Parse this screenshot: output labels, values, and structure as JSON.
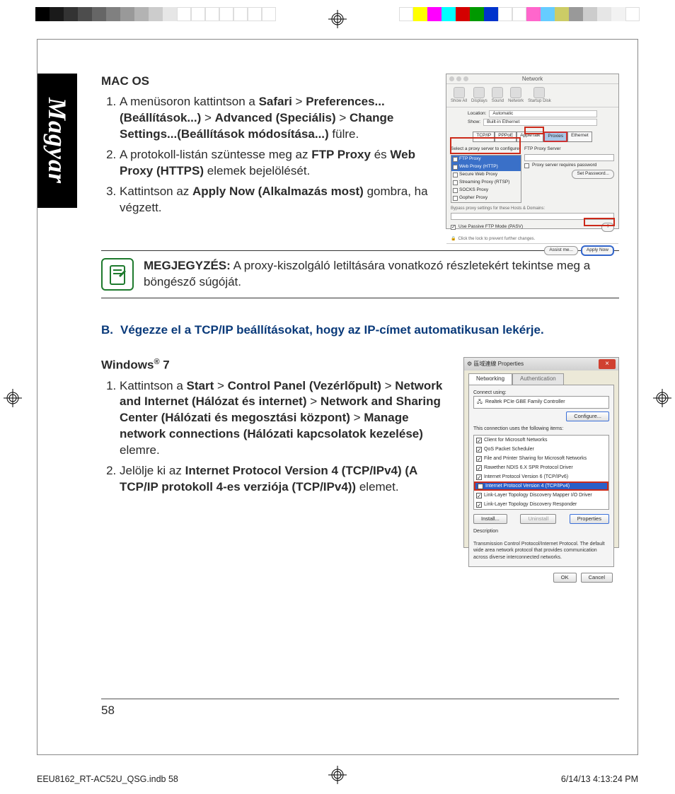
{
  "language_tab": "Magyar",
  "mac": {
    "heading": "MAC OS",
    "step1_parts": [
      "A menüsoron kattintson a ",
      "Safari",
      " > ",
      "Preferences... (Beállítások...)",
      " > ",
      "Advanced (Speciális)",
      " > ",
      "Change  Settings...(Beállítások módosítása...)",
      " fülre."
    ],
    "step2_parts": [
      "A protokoll-listán szüntesse meg az ",
      "FTP Proxy",
      " és ",
      "Web Proxy (HTTPS)",
      " elemek bejelölését."
    ],
    "step3_parts": [
      "Kattintson az ",
      "Apply Now (Alkalmazás most)",
      " gombra, ha végzett."
    ],
    "screenshot": {
      "title": "Network",
      "toolbar": [
        "Show All",
        "Displays",
        "Sound",
        "Network",
        "Startup Disk"
      ],
      "loc_label": "Location:",
      "loc_value": "Automatic",
      "show_label": "Show:",
      "show_value": "Built-in Ethernet",
      "tabs": [
        "TCP/IP",
        "PPPoE",
        "AppleTalk",
        "Proxies",
        "Ethernet"
      ],
      "selected_tab": "Proxies",
      "left_title": "Select a proxy server to configure:",
      "right_title": "FTP Proxy Server",
      "proxy_list": [
        {
          "label": "FTP Proxy",
          "checked": true,
          "sel": true
        },
        {
          "label": "Web Proxy (HTTP)",
          "checked": true,
          "sel": true
        },
        {
          "label": "Secure Web Proxy",
          "checked": false,
          "sel": false
        },
        {
          "label": "Streaming Proxy (RTSP)",
          "checked": false,
          "sel": false
        },
        {
          "label": "SOCKS Proxy",
          "checked": false,
          "sel": false
        },
        {
          "label": "Gopher Proxy",
          "checked": false,
          "sel": false
        }
      ],
      "pw_cb": "Proxy server requires password",
      "set_pw": "Set Password...",
      "bypass": "Bypass proxy settings for these Hosts & Domains:",
      "pasv": "Use Passive FTP Mode (PASV)",
      "lock": "Click the lock to prevent further changes.",
      "assist": "Assist me...",
      "apply": "Apply Now"
    }
  },
  "note": {
    "label": "MEGJEGYZÉS:",
    "text": "   A proxy-kiszolgáló letiltására vonatkozó részletekért tekintse meg a böngésző súgóját."
  },
  "sectionB": {
    "letter": "B.",
    "title": "Végezze el a TCP/IP beállításokat, hogy az IP-címet automatikusan lekérje."
  },
  "win": {
    "heading_base": "Windows",
    "heading_reg": "®",
    "heading_suffix": " 7",
    "step1_parts": [
      "Kattintson a ",
      "Start",
      " > ",
      "Control Panel (Vezérlőpult)",
      " > ",
      "Network and Internet (Hálózat és internet)",
      " > ",
      "Network and Sharing Center (Hálózati és megosztási központ)",
      " > ",
      "Manage network connections (Hálózati kapcsolatok kezelése)",
      " elemre."
    ],
    "step2_parts": [
      "Jelölje ki az ",
      "Internet Protocol Version 4 (TCP/IPv4) (A TCP/IP protokoll 4-es verziója (TCP/IPv4))",
      " elemet."
    ],
    "screenshot": {
      "title": "區域連線 Properties",
      "tabs": [
        "Networking",
        "Authentication"
      ],
      "connect_using": "Connect using:",
      "adapter": "Realtek PCIe GBE Family Controller",
      "configure": "Configure...",
      "uses_label": "This connection uses the following items:",
      "items": [
        "Client for Microsoft Networks",
        "QoS Packet Scheduler",
        "File and Printer Sharing for Microsoft Networks",
        "Rawether NDIS 6.X SPR Protocol Driver",
        "Internet Protocol Version 6 (TCP/IPv6)",
        "Internet Protocol Version 4 (TCP/IPv4)",
        "Link-Layer Topology Discovery Mapper I/O Driver",
        "Link-Layer Topology Discovery Responder"
      ],
      "selected_index": 5,
      "install": "Install...",
      "uninstall": "Uninstall",
      "properties": "Properties",
      "desc_label": "Description",
      "desc_text": "Transmission Control Protocol/Internet Protocol. The default wide area network protocol that provides communication across diverse interconnected networks.",
      "ok": "OK",
      "cancel": "Cancel"
    }
  },
  "page_number": "58",
  "print_meta": {
    "file": "EEU8162_RT-AC52U_QSG.indb   58",
    "stamp": "6/14/13   4:13:24 PM"
  },
  "colors": {
    "left": [
      "#000000",
      "#1a1a1a",
      "#333333",
      "#4d4d4d",
      "#666666",
      "#808080",
      "#999999",
      "#b3b3b3",
      "#cccccc",
      "#e6e6e6",
      "#ffffff",
      "#ffffff",
      "#ffffff",
      "#ffffff",
      "#ffffff",
      "#ffffff",
      "#ffffff"
    ],
    "right": [
      "#ffffff",
      "#ffff00",
      "#ff00ff",
      "#00ffff",
      "#d40000",
      "#009900",
      "#0033cc",
      "#ffffff",
      "#ffffff",
      "#ff66cc",
      "#66ccff",
      "#cccc66",
      "#999999",
      "#cccccc",
      "#e6e6e6",
      "#f2f2f2",
      "#ffffff"
    ]
  }
}
